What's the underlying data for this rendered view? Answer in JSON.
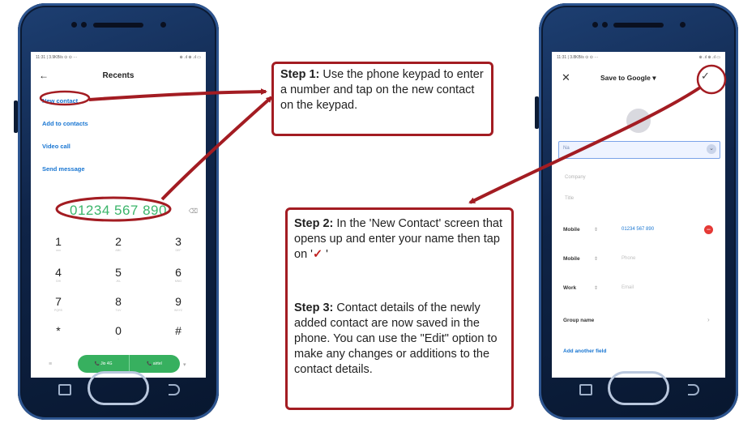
{
  "left_phone": {
    "status_left": "11:31 | 3.9KB/s ⊙ ⊙ ···",
    "status_right": "⊕ .ıl ⊕ .ıl ▭",
    "title": "Recents",
    "links": [
      "New contact",
      "Add to contacts",
      "Video call",
      "Send message"
    ],
    "dialed_number": "01234 567 890",
    "note": "",
    "keys": [
      {
        "d": "1",
        "s": "ooo"
      },
      {
        "d": "2",
        "s": "ABC"
      },
      {
        "d": "3",
        "s": "DEF"
      },
      {
        "d": "4",
        "s": "GHI"
      },
      {
        "d": "5",
        "s": "JKL"
      },
      {
        "d": "6",
        "s": "MNO"
      },
      {
        "d": "7",
        "s": "PQRS"
      },
      {
        "d": "8",
        "s": "TUV"
      },
      {
        "d": "9",
        "s": "WXYZ"
      },
      {
        "d": "*",
        "s": ""
      },
      {
        "d": "0",
        "s": "+"
      },
      {
        "d": "#",
        "s": ""
      }
    ],
    "call_sim1": "📞 Jio 4G",
    "call_sim2": "📞 airtel"
  },
  "right_phone": {
    "status_left": "11:31 | 3.8KB/s ⊙ ⊙ ···",
    "status_right": "⊕ .ıl ⊕ .ıl ▭",
    "close": "✕",
    "title": "Save to Google ▾",
    "check": "✓",
    "name_placeholder": "Na",
    "company_placeholder": "Company",
    "title_placeholder": "Title",
    "rows": [
      {
        "label": "Mobile",
        "value": "01234 567 890"
      },
      {
        "label": "Mobile",
        "value": "Phone"
      },
      {
        "label": "Work",
        "value": "Email"
      }
    ],
    "group_name": "Group name",
    "add_field": "Add another field"
  },
  "step1": {
    "heading": "Step 1:",
    "text": " Use the phone keypad to enter a number and tap on the new contact on the keypad."
  },
  "step2": {
    "heading": "Step 2:",
    "text": " In the 'New Contact' screen that opens up and enter your name then tap on '",
    "check": "✓",
    "end": " '"
  },
  "step3": {
    "heading": "Step 3:",
    "text": " Contact details of the newly added contact are now saved in the phone. You can use the \"Edit\" option to make any changes or additions to the contact details."
  },
  "colors": {
    "annotation_red": "#a31c22",
    "link_blue": "#1976d2",
    "call_green": "#37b05f"
  }
}
